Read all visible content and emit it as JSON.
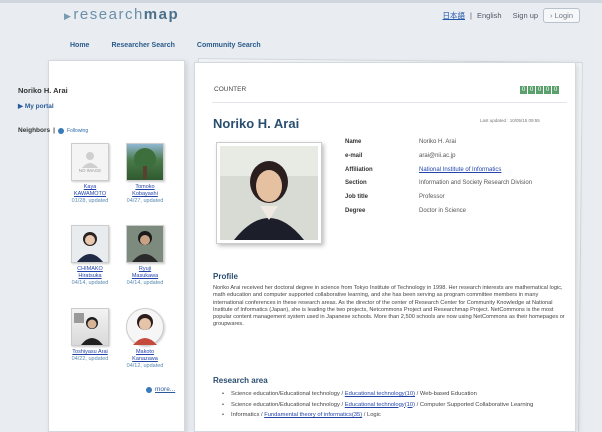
{
  "brand": {
    "prefix": "research",
    "suffix": "map"
  },
  "toplinks": {
    "japanese": "日本語",
    "english": "English",
    "signup": "Sign up",
    "login": "Login"
  },
  "nav": {
    "home": "Home",
    "researcher_search": "Researcher Search",
    "community_search": "Community Search"
  },
  "sidebar": {
    "user_name": "Noriko H. Arai",
    "my_portal": "My portal",
    "neighbors_label": "Neighbors",
    "following_label": "Following",
    "more": "more...",
    "neighbors": [
      {
        "name1": "Kaya",
        "name2": "KAWAMOTO",
        "date": "01/28, updated",
        "thumb": "no-image"
      },
      {
        "name1": "Tomoko",
        "name2": "Kobayashi",
        "date": "04/27, updated",
        "thumb": "tree"
      },
      {
        "name1": "CHIMAKO",
        "name2": "Hiratsuka",
        "date": "04/14, updated",
        "thumb": "person-light"
      },
      {
        "name1": "Ryuji",
        "name2": "Masukawa",
        "date": "04/14, updated",
        "thumb": "person-dark"
      },
      {
        "name1": "Toshiyasu Arai",
        "name2": "",
        "date": "04/22, updated",
        "thumb": "person-office"
      },
      {
        "name1": "Makoto",
        "name2": "Kanazawa",
        "date": "04/12, updated",
        "thumb": "person-round"
      }
    ],
    "no_image_text": "NO IMAGE"
  },
  "main": {
    "counter_label": "COUNTER",
    "counter_digits": [
      "0",
      "0",
      "0",
      "0",
      "0"
    ],
    "name": "Noriko H. Arai",
    "last_updated": "Last updated : 10/05/15 09:55",
    "info": [
      {
        "key": "Name",
        "value": "Noriko H. Arai",
        "is_link": false
      },
      {
        "key": "e-mail",
        "value": "arai@nii.ac.jp",
        "is_link": false
      },
      {
        "key": "Affiliation",
        "value": "National Institute of Informatics",
        "is_link": true
      },
      {
        "key": "Section",
        "value": "Information and Society Research Division",
        "is_link": false
      },
      {
        "key": "Job title",
        "value": "Professor",
        "is_link": false
      },
      {
        "key": "Degree",
        "value": "Doctor in Science",
        "is_link": false
      }
    ],
    "profile_title": "Profile",
    "profile_text": "Noriko Arai received her doctoral degree in science from Tokyo Institute of Technology in 1998. Her research interests are mathematical logic, math education and computer supported collaborative learning, and she has been serving as program committee members in many international conferences in these research areas. As the director of the center of Research Center for Community Knowledge at National Institute of Informatics (Japan), she is leading the two projects, Netcommons Project and Researchmap Project. NetCommons is the most popular content management system used in Japanese schools. More than 2,500 schools are now using NetCommons as their homepages or groupwares.",
    "research_title": "Research area",
    "research_areas": [
      {
        "prefix": "Science education/Educational technology / ",
        "link": "Educational technology(10)",
        "suffix": " / Web-based Education"
      },
      {
        "prefix": "Science education/Educational technology / ",
        "link": "Educational technology(10)",
        "suffix": " / Computer Supported Collaborative Learning"
      },
      {
        "prefix": "Informatics / ",
        "link": "Fundamental theory of informatics(35)",
        "suffix": " / Logic"
      }
    ]
  }
}
